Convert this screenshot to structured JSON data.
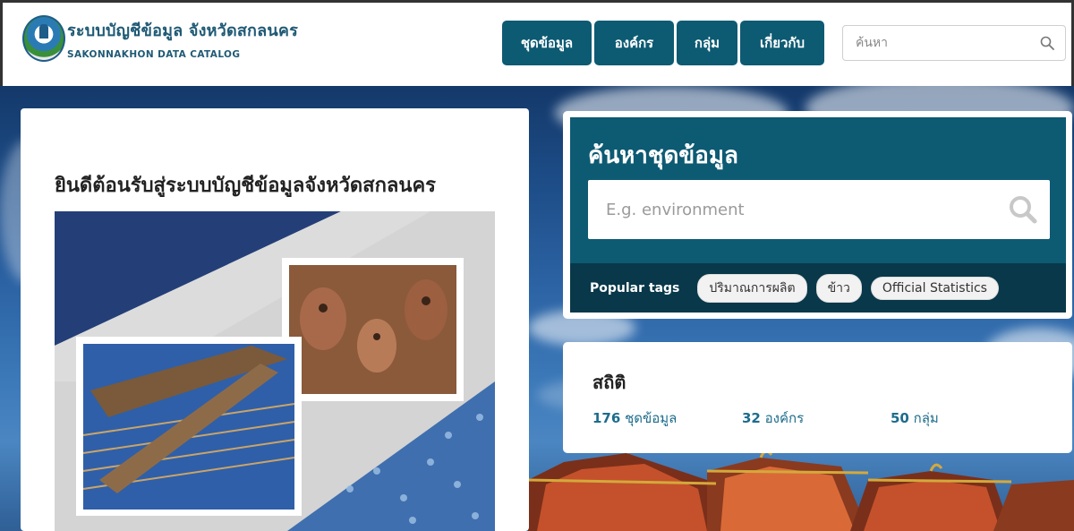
{
  "header": {
    "logo_title": "ระบบบัญชีข้อมูล จังหวัดสกลนคร",
    "logo_subtitle": "SAKONNAKHON DATA CATALOG",
    "nav": [
      "ชุดข้อมูล",
      "องค์กร",
      "กลุ่ม",
      "เกี่ยวกับ"
    ],
    "search_placeholder": "ค้นหา"
  },
  "welcome": {
    "title": "ยินดีต้อนรับสู่ระบบบัญชีข้อมูลจังหวัดสกลนคร"
  },
  "search_panel": {
    "title": "ค้นหาชุดข้อมูล",
    "placeholder": "E.g. environment",
    "popular_label": "Popular tags",
    "tags": [
      "ปริมาณการผลิต",
      "ข้าว",
      "Official Statistics"
    ]
  },
  "stats": {
    "title": "สถิติ",
    "datasets_count": "176",
    "datasets_label": "ชุดข้อมูล",
    "orgs_count": "32",
    "orgs_label": "องค์กร",
    "groups_count": "50",
    "groups_label": "กลุ่ม"
  },
  "colors": {
    "brand": "#0d5a73",
    "brand_dark": "#08384a",
    "link": "#1d6c8c"
  },
  "icons": [
    "logo-emblem",
    "search-icon"
  ]
}
